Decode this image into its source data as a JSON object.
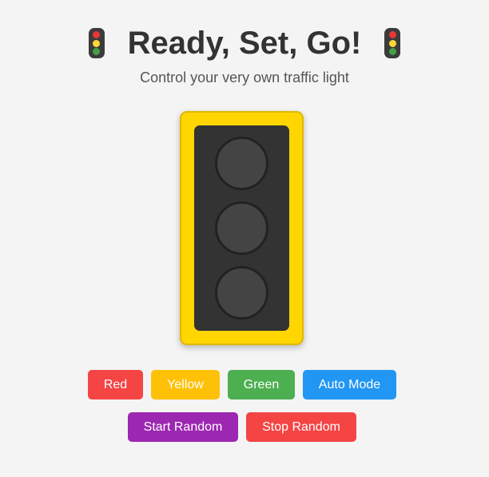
{
  "header": {
    "title": "Ready, Set, Go!",
    "subtitle": "Control your very own traffic light",
    "icon": "traffic-light-emoji"
  },
  "traffic_light": {
    "housing_color": "#ffd600",
    "panel_color": "#333333",
    "lamp_off_color": "#444444",
    "active_lamp": "none",
    "lamps": [
      "red",
      "yellow",
      "green"
    ]
  },
  "controls": {
    "red_label": "Red",
    "yellow_label": "Yellow",
    "green_label": "Green",
    "auto_label": "Auto Mode",
    "start_random_label": "Start Random",
    "stop_random_label": "Stop Random"
  },
  "colors": {
    "red": "#f44444",
    "yellow": "#ffc107",
    "green": "#4caf50",
    "auto": "#2196f3",
    "start_random": "#9c27b0",
    "stop_random": "#f44444",
    "icon_red": "#e53935",
    "icon_yellow": "#fdd835",
    "icon_green": "#43a047"
  }
}
